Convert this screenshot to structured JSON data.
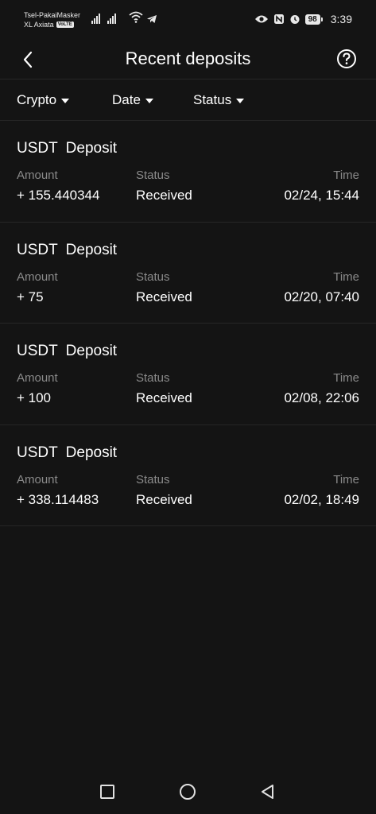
{
  "status_bar": {
    "carrier_1": "Tsel-PakaiMasker",
    "carrier_2": "XL Axiata",
    "carrier_2_badge": "VoLTE",
    "battery": "98",
    "time": "3:39"
  },
  "header": {
    "title": "Recent deposits"
  },
  "filters": [
    {
      "label": "Crypto"
    },
    {
      "label": "Date"
    },
    {
      "label": "Status"
    }
  ],
  "labels": {
    "amount": "Amount",
    "status": "Status",
    "time": "Time"
  },
  "deposits": [
    {
      "title": "USDT Deposit",
      "amount": "+ 155.440344",
      "status": "Received",
      "time": "02/24, 15:44"
    },
    {
      "title": "USDT Deposit",
      "amount": "+ 75",
      "status": "Received",
      "time": "02/20, 07:40"
    },
    {
      "title": "USDT Deposit",
      "amount": "+ 100",
      "status": "Received",
      "time": "02/08, 22:06"
    },
    {
      "title": "USDT Deposit",
      "amount": "+ 338.114483",
      "status": "Received",
      "time": "02/02, 18:49"
    }
  ],
  "icons": {
    "back": "chevron-left-icon",
    "help": "question-circle-icon",
    "nav_recents": "square-icon",
    "nav_home": "circle-icon",
    "nav_back": "triangle-back-icon"
  },
  "colors": {
    "background": "#141414",
    "divider": "#262626",
    "text_primary": "#ffffff",
    "text_secondary": "#8a8a8a"
  }
}
